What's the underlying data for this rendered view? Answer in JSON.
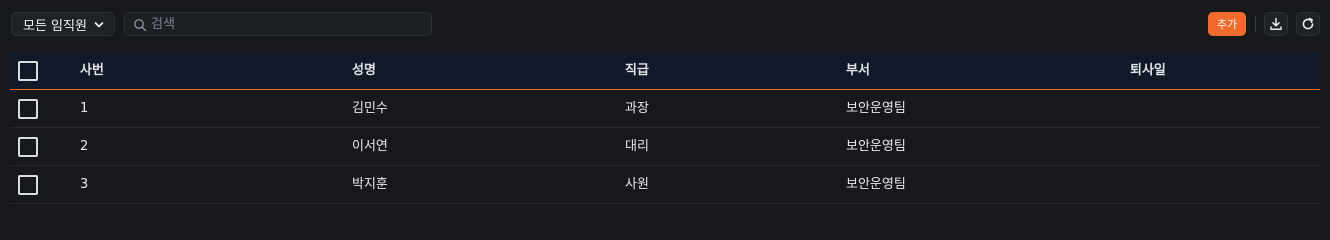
{
  "toolbar": {
    "filter_label": "모든 임직원",
    "search_placeholder": "검색",
    "add_label": "추가"
  },
  "table": {
    "headers": {
      "id": "사번",
      "name": "성명",
      "rank": "직급",
      "dept": "부서",
      "retire_date": "퇴사일"
    },
    "rows": [
      {
        "id": "1",
        "name": "김민수",
        "rank": "과장",
        "dept": "보안운영팀",
        "retire_date": ""
      },
      {
        "id": "2",
        "name": "이서연",
        "rank": "대리",
        "dept": "보안운영팀",
        "retire_date": ""
      },
      {
        "id": "3",
        "name": "박지훈",
        "rank": "사원",
        "dept": "보안운영팀",
        "retire_date": ""
      }
    ]
  },
  "colors": {
    "accent": "#f26b2c",
    "background": "#16181c",
    "header_bg": "#111827"
  },
  "icons": [
    "chevron-down-icon",
    "search-icon",
    "download-icon",
    "refresh-icon"
  ]
}
